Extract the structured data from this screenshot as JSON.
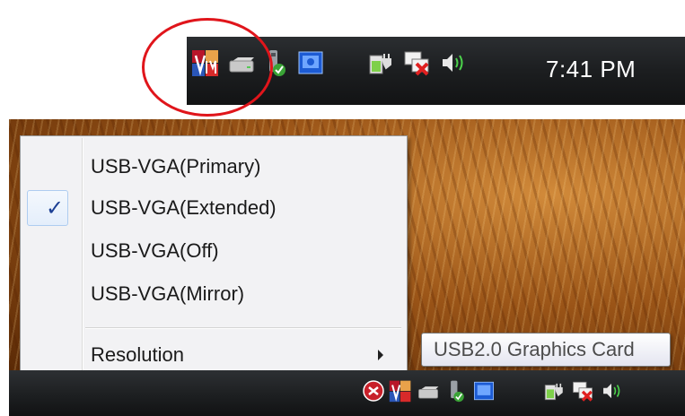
{
  "tray_top": {
    "clock": "7:41 PM",
    "icons": [
      "vga-app-icon",
      "drive-icon",
      "usb-safe-remove-icon",
      "graphics-card-icon",
      "power-plug-icon",
      "network-disconnected-icon",
      "speaker-icon"
    ]
  },
  "context_menu": {
    "items": [
      {
        "label": "USB-VGA(Primary)",
        "checked": false
      },
      {
        "label": "USB-VGA(Extended)",
        "checked": true
      },
      {
        "label": "USB-VGA(Off)",
        "checked": false
      },
      {
        "label": "USB-VGA(Mirror)",
        "checked": false
      }
    ],
    "submenu": {
      "label": "Resolution"
    }
  },
  "tooltip": {
    "text": "USB2.0 Graphics Card"
  },
  "tray_bottom": {
    "icons": [
      "shield-icon",
      "vga-app-icon",
      "drive-icon",
      "usb-safe-remove-icon",
      "graphics-card-icon",
      "power-plug-icon",
      "network-disconnected-icon",
      "speaker-icon"
    ]
  },
  "colors": {
    "highlight": "#e0151b",
    "checkmark": "#1c3f94",
    "taskbar": "#1d1f21"
  }
}
